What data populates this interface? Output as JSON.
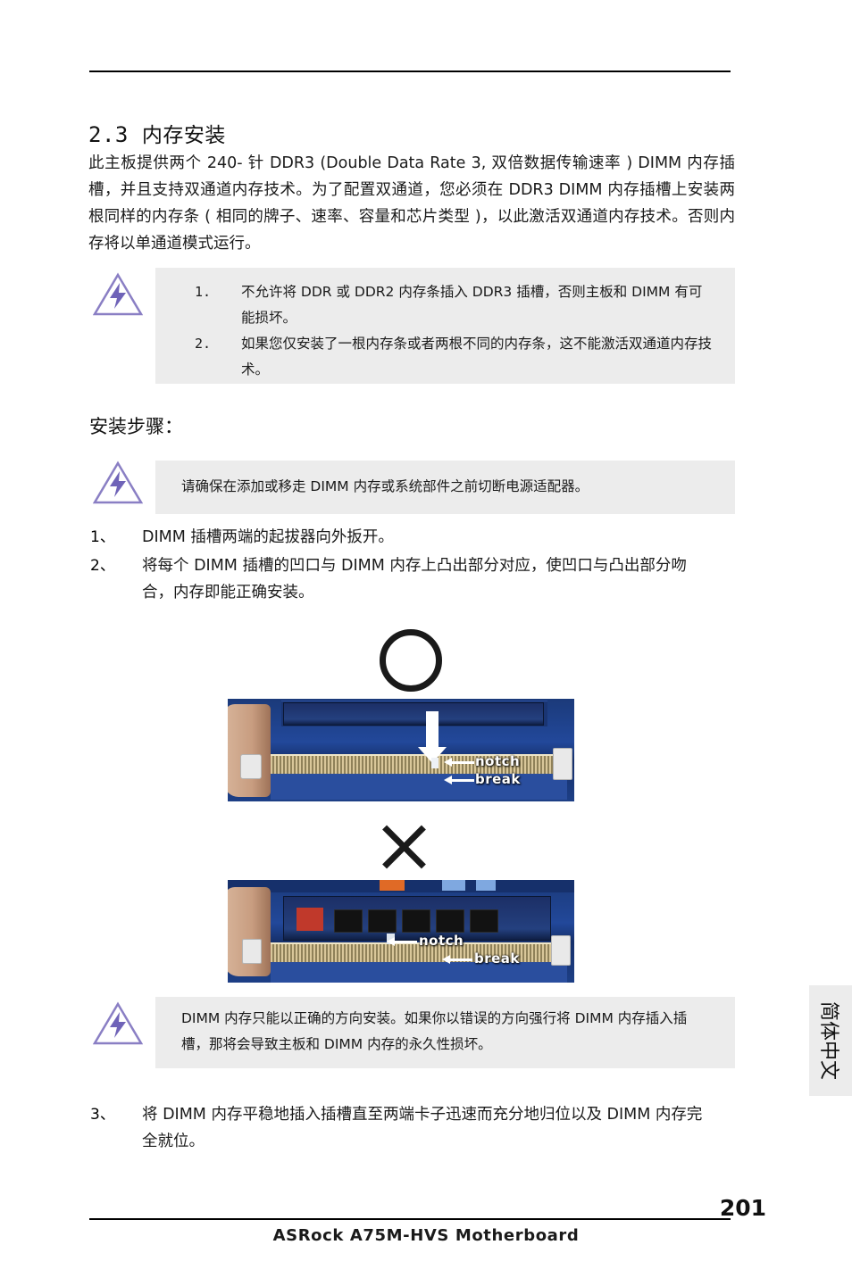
{
  "document": {
    "section_number": "2.3",
    "section_title": "内存安装",
    "intro_paragraph": "此主板提供两个 240- 针 DDR3 (Double Data Rate 3, 双倍数据传输速率 ) DIMM 内存插槽，并且支持双通道内存技术。为了配置双通道，您必须在 DDR3 DIMM 内存插槽上安装两根同样的内存条 ( 相同的牌子、速率、容量和芯片类型 )，以此激活双通道内存技术。否则内存将以单通道模式运行。",
    "note_box_1": {
      "items": [
        {
          "number": "1.",
          "text": "不允许将 DDR 或 DDR2 内存条插入 DDR3 插槽，否则主板和 DIMM 有可能损坏。"
        },
        {
          "number": "2.",
          "text": "如果您仅安装了一根内存条或者两根不同的内存条，这不能激活双通道内存技术。"
        }
      ]
    },
    "steps_heading": "安装步骤：",
    "note_box_2": {
      "text": "请确保在添加或移走 DIMM 内存或系统部件之前切断电源适配器。"
    },
    "steps": [
      {
        "number": "1、",
        "text": "DIMM 插槽两端的起拔器向外扳开。"
      },
      {
        "number": "2、",
        "text": "将每个 DIMM 插槽的凹口与 DIMM 内存上凸出部分对应，使凹口与凸出部分吻合，内存即能正确安装。"
      },
      {
        "number": "3、",
        "text": "将 DIMM 内存平稳地插入插槽直至两端卡子迅速而充分地归位以及 DIMM 内存完全就位。"
      }
    ],
    "figures": {
      "correct_marker": "circle-ok",
      "incorrect_marker": "cross-x",
      "top_photo_labels": [
        "notch",
        "break"
      ],
      "bottom_photo_labels": [
        "notch",
        "break"
      ]
    },
    "note_box_3": {
      "text": "DIMM 内存只能以正确的方向安装。如果你以错误的方向强行将 DIMM 内存插入插槽，那将会导致主板和 DIMM 内存的永久性损坏。"
    },
    "side_tab_label": "简体中文",
    "page_number": "201",
    "footer_text": "ASRock  A75M-HVS  Motherboard"
  }
}
